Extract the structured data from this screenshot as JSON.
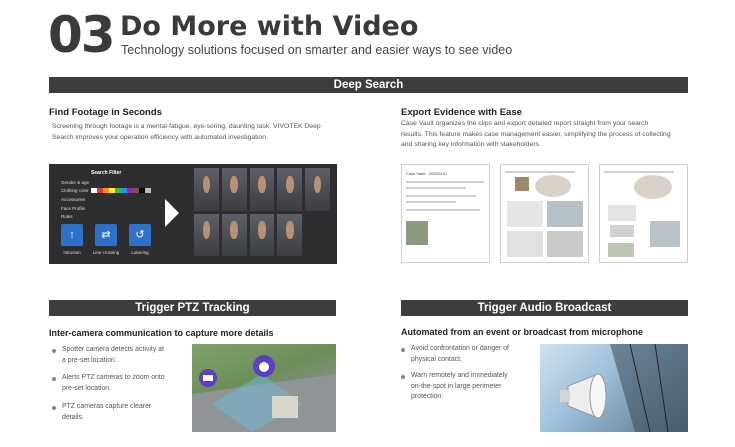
{
  "header": {
    "number": "03",
    "title": "Do More with Video",
    "subtitle": "Technology solutions focused on smarter and easier ways to see video"
  },
  "deep_search": {
    "banner": "Deep Search",
    "find": {
      "heading": "Find Footage in Seconds",
      "text_1": "Screening through footage is a mental-fatigue, eye-soring, daunting task. VIVOTEK Deep",
      "text_2": "Search improves your operation efficiency with automated investigation."
    },
    "export": {
      "heading": "Export Evidence with Ease",
      "text_1": "Case Vault organizes the clips and export detailed report straight from your search",
      "text_2": "results. This feature makes case management easier, simplifying the process of collecting",
      "text_3": "and sharing key information with stakeholders."
    },
    "panel": {
      "title": "Search Filter",
      "filters": [
        "Gender & age",
        "Clothing color",
        "Accessories",
        "Face Profile",
        "Rules"
      ],
      "buttons": [
        "Intrusion",
        "Line crossing",
        "Loitering"
      ],
      "swatches": [
        "#ffffff",
        "#e53935",
        "#ff9800",
        "#ffeb3b",
        "#4caf50",
        "#2196f3",
        "#9c27b0",
        "#795548",
        "#000000",
        "#bdbdbd"
      ]
    },
    "report_title": "Case Vault - 20200410"
  },
  "ptz": {
    "banner": "Trigger PTZ Tracking",
    "heading": "Inter-camera communication to capture more details",
    "bullets": [
      {
        "line_1": "Spotter camera detects activity at",
        "line_2": "a pre-set location."
      },
      {
        "line_1": "Alerts PTZ cameras to zoom onto",
        "line_2": "pre-set location."
      },
      {
        "line_1": "PTZ cameras capture clearer",
        "line_2": "details."
      }
    ]
  },
  "audio": {
    "banner": "Trigger Audio Broadcast",
    "heading": "Automated from an event or broadcast from microphone",
    "bullets": [
      {
        "line_1": "Avoid confrontation or danger of",
        "line_2": "physical contact.",
        "line_3": ""
      },
      {
        "line_1": "Warn remotely and immediately",
        "line_2": "on-the-spot in large perimeter",
        "line_3": "protection."
      }
    ]
  },
  "colors": {
    "banner": "#3d3d3d",
    "accent": "#2d72c8"
  },
  "icons": [
    "arrow-right-icon",
    "intrusion-icon",
    "line-crossing-icon",
    "loitering-icon",
    "speaker-horn-icon",
    "ptz-camera-icon",
    "spotter-camera-icon"
  ]
}
